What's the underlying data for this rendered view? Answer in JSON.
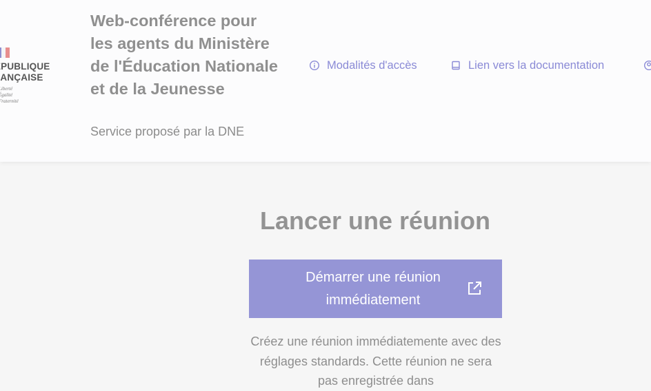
{
  "header": {
    "logo": {
      "line1": "RÉPUBLIQUE",
      "line2": "FRANÇAISE",
      "devise": [
        "Liberté",
        "Égalité",
        "Fraternité"
      ]
    },
    "service_title": "Web-conférence pour les agents du Ministère de l'Éducation Nationale et de la Jeunesse",
    "service_tagline": "Service proposé par la DNE",
    "nav": [
      {
        "label": "Modalités d'accès",
        "icon": "info-icon"
      },
      {
        "label": "Lien vers la documentation",
        "icon": "book-icon"
      },
      {
        "label": "",
        "icon": "user-icon"
      }
    ]
  },
  "main": {
    "heading": "Lancer une réunion",
    "start_button": {
      "label": "Démarrer une réunion immédiatement",
      "icon": "external-link-icon"
    },
    "description": "Créez une réunion immédiatemente avec des réglages standards. Cette réunion ne sera pas enregistrée dans"
  },
  "colors": {
    "accent": "#9595d6",
    "link": "#8a8ad6",
    "text_muted": "#8f8f8f",
    "background": "#f6f6f6",
    "header_bg": "#fcfcfd"
  }
}
